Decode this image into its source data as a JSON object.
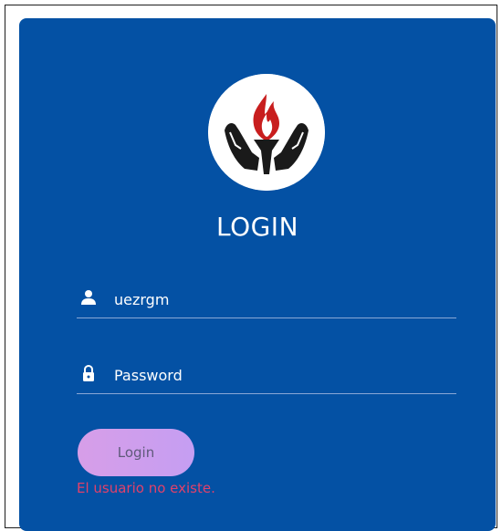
{
  "login": {
    "title": "LOGIN",
    "username": {
      "value": "uezrgm",
      "icon": "user-icon"
    },
    "password": {
      "placeholder": "Password",
      "icon": "lock-icon"
    },
    "submit_label": "Login",
    "error_message": "El usuario no existe."
  },
  "colors": {
    "card_background": "#0451a4",
    "error_text": "#e2416a",
    "button_gradient_start": "#d79ee8",
    "button_gradient_end": "#c59ef2"
  }
}
